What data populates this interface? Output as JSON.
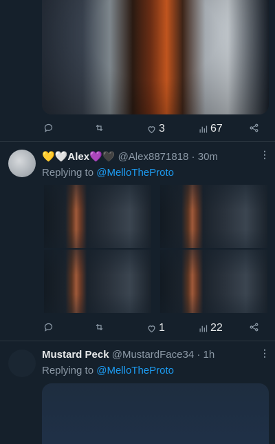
{
  "tweet1": {
    "media_alt": "",
    "actions": {
      "reply": "",
      "retweet": "",
      "like": "3",
      "views": "67"
    }
  },
  "tweet2": {
    "emoji_prefix": "💛🤍",
    "name": "Alex",
    "emoji_suffix": "💜🖤",
    "handle": "@Alex8871818",
    "time": "30m",
    "replying_prefix": "Replying to ",
    "replying_to": "@MelloTheProto",
    "actions": {
      "reply": "",
      "retweet": "",
      "like": "1",
      "views": "22"
    }
  },
  "tweet3": {
    "name": "Mustard Peck",
    "handle": "@MustardFace34",
    "time": "1h",
    "replying_prefix": "Replying to ",
    "replying_to": "@MelloTheProto"
  },
  "separator": " · ",
  "colors": {
    "background": "#15202b",
    "accent": "#1d9bf0",
    "muted": "#8b98a5",
    "divider": "#2b3640"
  }
}
